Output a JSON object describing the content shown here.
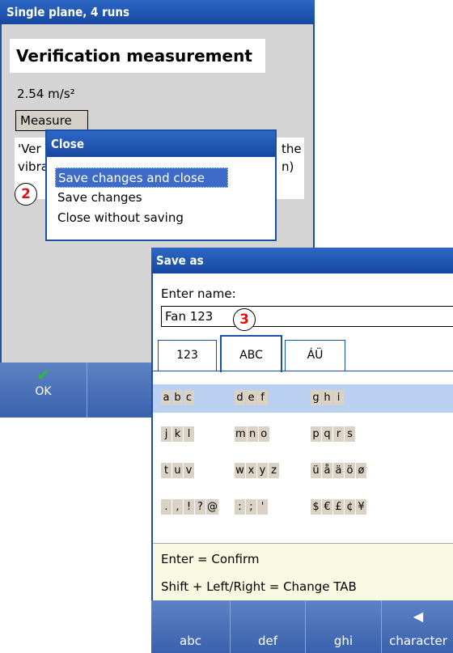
{
  "window1": {
    "title": "Single plane, 4 runs",
    "heading": "Verification measurement",
    "value": "2.54 m/s²",
    "measure_button": "Measure",
    "description_left": [
      "'Ver",
      "vibra"
    ],
    "description_right": [
      "the",
      "n)"
    ],
    "softkey_ok": "OK"
  },
  "close_popup": {
    "title": "Close",
    "items": [
      "Save changes and close",
      "Save changes",
      "Close without saving"
    ],
    "badge": "2"
  },
  "save_window": {
    "title": "Save as",
    "enter_label": "Enter name:",
    "name_value": "Fan 123",
    "badge": "3",
    "tabs": [
      "123",
      "ABC",
      "ÁÜ"
    ],
    "keyboard_rows": [
      [
        "abc",
        "def",
        "ghi"
      ],
      [
        "jkl",
        "mno",
        "pqrs"
      ],
      [
        "tuv",
        "wxyz",
        "üåäöø"
      ],
      [
        ".,!?@",
        ":;'",
        "$€£¢¥"
      ]
    ],
    "hint1": "Enter = Confirm",
    "hint2": "Shift + Left/Right = Change TAB",
    "softkeys": [
      "abc",
      "def",
      "ghi",
      "character"
    ]
  },
  "colors": {
    "titlebar": "#1d4fa8",
    "selection": "#3f6bc8",
    "badge_number": "#e01010",
    "key_background": "#d9d2c5"
  }
}
